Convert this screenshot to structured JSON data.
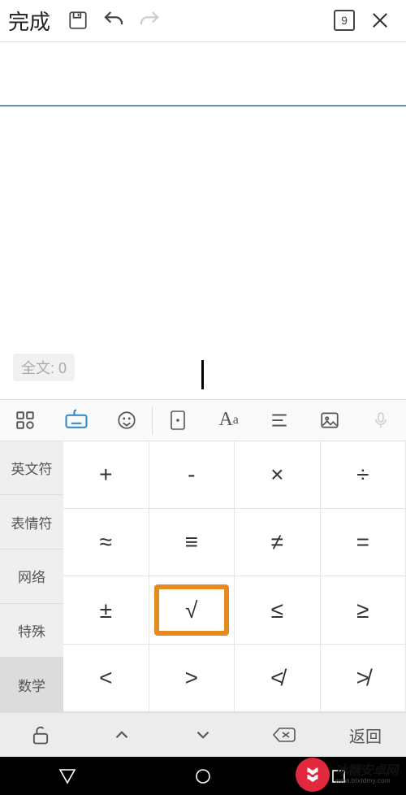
{
  "topbar": {
    "done_label": "完成",
    "page_number": "9"
  },
  "editor": {
    "wordcount_label": "全文: 0"
  },
  "keyboard": {
    "tabs": [
      {
        "label": "英文符"
      },
      {
        "label": "表情符"
      },
      {
        "label": "网络"
      },
      {
        "label": "特殊"
      },
      {
        "label": "数学"
      }
    ],
    "selected_tab_index": 4,
    "keys": [
      "+",
      "-",
      "×",
      "÷",
      "≈",
      "≡",
      "≠",
      "=",
      "±",
      "√",
      "≤",
      "≥",
      "<",
      ">",
      "≮",
      "≯"
    ],
    "highlight_index": 9,
    "return_label": "返回"
  },
  "watermark": {
    "brand": "冰糖安卓网",
    "url": "www.btxtdmy.com"
  }
}
